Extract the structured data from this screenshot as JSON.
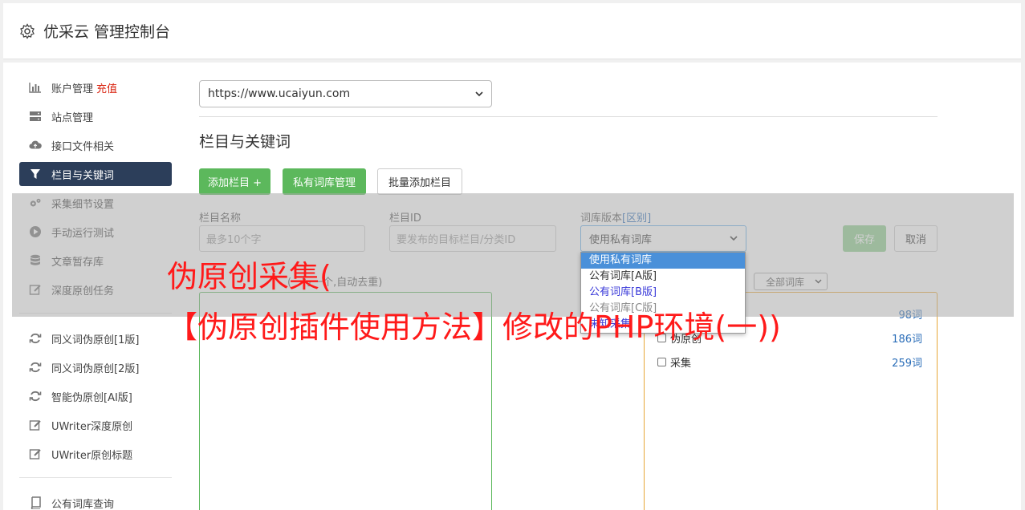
{
  "app": {
    "title": "优采云 管理控制台"
  },
  "sidebar": {
    "items": [
      {
        "label": "账户管理",
        "badge": "充值",
        "icon": "bar-chart-icon"
      },
      {
        "label": "站点管理",
        "icon": "server-icon"
      },
      {
        "label": "接口文件相关",
        "icon": "cloud-upload-icon"
      },
      {
        "label": "栏目与关键词",
        "icon": "filter-icon",
        "active": true
      },
      {
        "label": "采集细节设置",
        "icon": "cogs-icon"
      },
      {
        "label": "手动运行测试",
        "icon": "play-circle-icon"
      },
      {
        "label": "文章暂存库",
        "icon": "database-icon"
      },
      {
        "label": "深度原创任务",
        "icon": "edit-icon"
      },
      {
        "label": "同义词伪原创[1版]",
        "icon": "refresh-icon"
      },
      {
        "label": "同义词伪原创[2版]",
        "icon": "refresh-icon"
      },
      {
        "label": "智能伪原创[AI版]",
        "icon": "refresh-icon"
      },
      {
        "label": "UWriter深度原创",
        "icon": "edit-icon"
      },
      {
        "label": "UWriter原创标题",
        "icon": "edit-icon"
      },
      {
        "label": "公有词库查询",
        "icon": "book-icon"
      }
    ]
  },
  "site_select": {
    "value": "https://www.ucaiyun.com"
  },
  "section": {
    "title": "栏目与关键词"
  },
  "buttons": {
    "add_column": "添加栏目 +",
    "private_lib": "私有词库管理",
    "batch_add": "批量添加栏目",
    "save": "保存",
    "cancel": "取消"
  },
  "form": {
    "name_label": "栏目名称",
    "name_placeholder": "最多10个字",
    "id_label": "栏目ID",
    "id_placeholder": "要发布的目标栏目/分类ID",
    "lib_label": "词库版本",
    "lib_label_link": "[区别]",
    "lib_value": "使用私有词库"
  },
  "dropdown": {
    "options": [
      "使用私有词库",
      "公有词库[A版]",
      "公有词库[B版]",
      "公有词库[C版]",
      "未知采集"
    ]
  },
  "keywords_box": {
    "label": "(一行一个,自动去重)"
  },
  "lib_filter": {
    "value": "全部词库"
  },
  "libraries": [
    {
      "name": "",
      "count": "98词"
    },
    {
      "name": "伪原创",
      "count": "186词"
    },
    {
      "name": "采集",
      "count": "259词"
    }
  ],
  "watermark": {
    "line1": "伪原创采集(",
    "line2": "【伪原创插件使用方法】修改的PHP环境(一))"
  }
}
